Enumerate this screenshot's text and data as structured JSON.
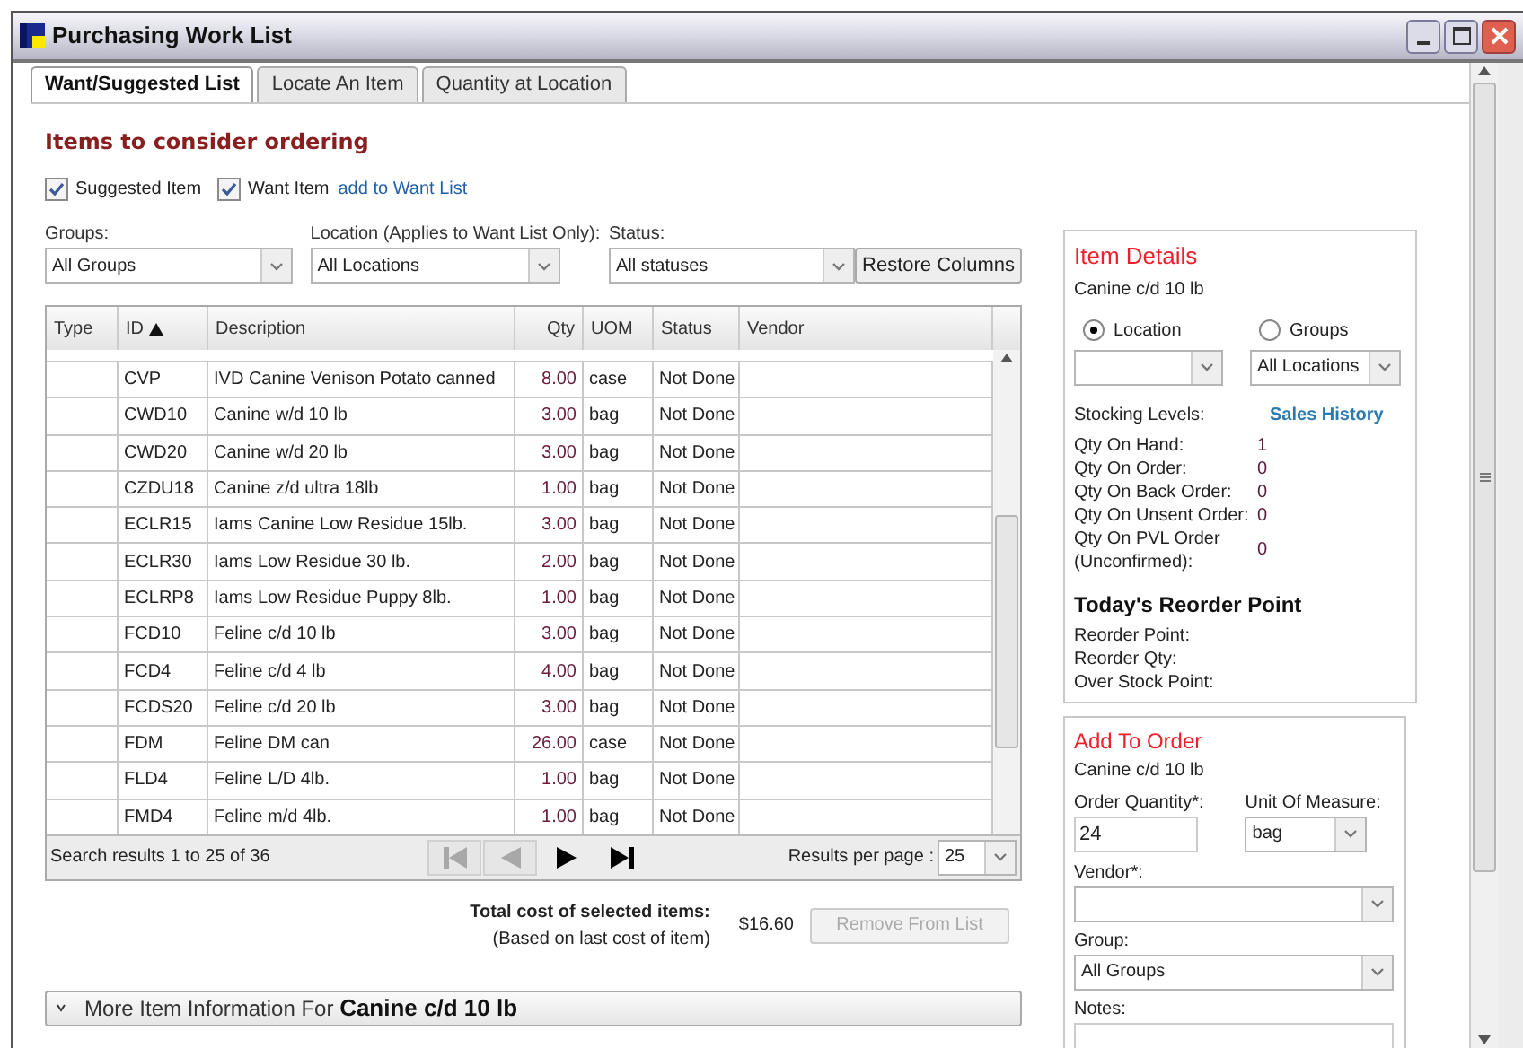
{
  "window": {
    "title": "Purchasing Work List"
  },
  "tabs": [
    {
      "label": "Want/Suggested List",
      "selected": true
    },
    {
      "label": "Locate An Item",
      "selected": false
    },
    {
      "label": "Quantity at Location",
      "selected": false
    }
  ],
  "main": {
    "heading": "Items to consider ordering",
    "checkboxes": [
      {
        "label": "Suggested Item",
        "checked": true
      },
      {
        "label": "Want Item",
        "checked": true
      }
    ],
    "link": "add to Want List",
    "filters": [
      {
        "label": "Groups:",
        "value": "All Groups"
      },
      {
        "label": "Location (Applies to Want List Only):",
        "value": "All Locations"
      },
      {
        "label": "Status:",
        "value": "All statuses"
      }
    ],
    "restore_button": "Restore Columns"
  },
  "table": {
    "columns": [
      {
        "label": "Type",
        "sorted": false
      },
      {
        "label": "ID",
        "sorted": true
      },
      {
        "label": "Description",
        "sorted": false
      },
      {
        "label": "Qty",
        "sorted": false
      },
      {
        "label": "UOM",
        "sorted": false
      },
      {
        "label": "Status",
        "sorted": false
      },
      {
        "label": "Vendor",
        "sorted": false
      }
    ],
    "rows": [
      {
        "id": "CVP",
        "description": "IVD Canine Venison Potato canned",
        "qty": "8.00",
        "uom": "case",
        "status": "Not Done"
      },
      {
        "id": "CWD10",
        "description": "Canine w/d 10 lb",
        "qty": "3.00",
        "uom": "bag",
        "status": "Not Done"
      },
      {
        "id": "CWD20",
        "description": "Canine w/d 20 lb",
        "qty": "3.00",
        "uom": "bag",
        "status": "Not Done"
      },
      {
        "id": "CZDU18",
        "description": "Canine z/d ultra 18lb",
        "qty": "1.00",
        "uom": "bag",
        "status": "Not Done"
      },
      {
        "id": "ECLR15",
        "description": "Iams Canine Low Residue 15lb.",
        "qty": "3.00",
        "uom": "bag",
        "status": "Not Done"
      },
      {
        "id": "ECLR30",
        "description": "Iams Low Residue 30 lb.",
        "qty": "2.00",
        "uom": "bag",
        "status": "Not Done"
      },
      {
        "id": "ECLRP8",
        "description": "Iams Low Residue Puppy 8lb.",
        "qty": "1.00",
        "uom": "bag",
        "status": "Not Done"
      },
      {
        "id": "FCD10",
        "description": "Feline c/d 10 lb",
        "qty": "3.00",
        "uom": "bag",
        "status": "Not Done"
      },
      {
        "id": "FCD4",
        "description": "Feline c/d 4 lb",
        "qty": "4.00",
        "uom": "bag",
        "status": "Not Done"
      },
      {
        "id": "FCDS20",
        "description": "Feline c/d 20 lb",
        "qty": "3.00",
        "uom": "bag",
        "status": "Not Done"
      },
      {
        "id": "FDM",
        "description": "Feline DM can",
        "qty": "26.00",
        "uom": "case",
        "status": "Not Done"
      },
      {
        "id": "FLD4",
        "description": "Feline L/D 4lb.",
        "qty": "1.00",
        "uom": "bag",
        "status": "Not Done"
      },
      {
        "id": "FMD4",
        "description": "Feline m/d 4lb.",
        "qty": "1.00",
        "uom": "bag",
        "status": "Not Done"
      }
    ],
    "pager": {
      "summary": "Search results 1 to 25 of 36",
      "buttons": [
        {
          "kind": "first",
          "disabled": true
        },
        {
          "kind": "prev",
          "disabled": true
        },
        {
          "kind": "next",
          "disabled": false
        },
        {
          "kind": "last",
          "disabled": false
        }
      ],
      "per_page_label": "Results per page :",
      "per_page": "25"
    }
  },
  "total": {
    "label": "Total cost of selected items:",
    "note": "(Based on last cost of item)",
    "amount": "$16.60",
    "button": {
      "label": "Remove From List",
      "disabled": true
    }
  },
  "more_info": {
    "prefix": "More Item Information For",
    "item": "Canine c/d 10 lb",
    "expanded": false
  },
  "item_details": {
    "title": "Item Details",
    "item": "Canine c/d 10 lb",
    "radios": [
      {
        "label": "Location",
        "selected": true
      },
      {
        "label": "Groups",
        "selected": false,
        "value": "All Locations"
      }
    ],
    "stocking_label": "Stocking Levels:",
    "sales_link": "Sales History",
    "stats": [
      {
        "label": "Qty On Hand:",
        "value": "1"
      },
      {
        "label": "Qty On Order:",
        "value": "0"
      },
      {
        "label": "Qty On Back Order:",
        "value": "0"
      },
      {
        "label": "Qty On Unsent Order:",
        "value": "0"
      },
      {
        "label": "Qty On PVL Order (Unconfirmed):",
        "value": "0"
      }
    ],
    "reorder_heading": "Today's Reorder Point",
    "reorder_fields": [
      "Reorder Point:",
      "Reorder Qty:",
      "Over Stock Point:"
    ]
  },
  "add_to_order": {
    "title": "Add To Order",
    "item": "Canine c/d 10 lb",
    "quantity": {
      "label": "Order Quantity*:",
      "value": "24"
    },
    "uom": {
      "label": "Unit Of Measure:",
      "value": "bag"
    },
    "vendor": {
      "label": "Vendor*:"
    },
    "group": {
      "label": "Group:",
      "value": "All Groups"
    },
    "notes": {
      "label": "Notes:"
    }
  }
}
